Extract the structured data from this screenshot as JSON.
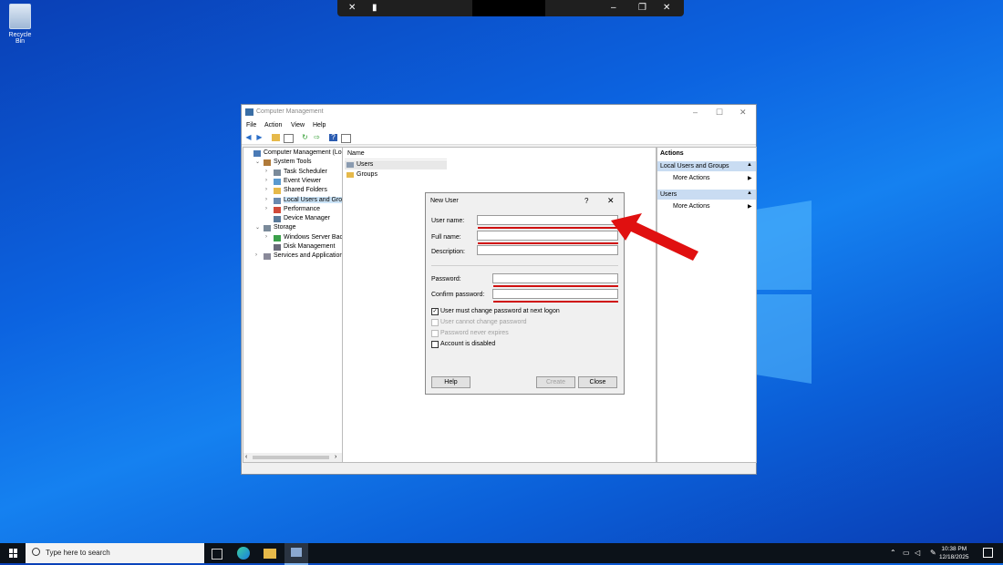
{
  "desktop": {
    "recycle_bin_label": "Recycle Bin"
  },
  "window": {
    "title": "Computer Management",
    "menu": [
      "File",
      "Action",
      "View",
      "Help"
    ],
    "tree": [
      {
        "label": "Computer Management (Local",
        "level": 0,
        "icon": "computer-icon",
        "expander": ""
      },
      {
        "label": "System Tools",
        "level": 1,
        "icon": "tools-icon",
        "expander": "v"
      },
      {
        "label": "Task Scheduler",
        "level": 2,
        "icon": "clock-icon",
        "expander": ">"
      },
      {
        "label": "Event Viewer",
        "level": 2,
        "icon": "event-viewer-icon",
        "expander": ">"
      },
      {
        "label": "Shared Folders",
        "level": 2,
        "icon": "folder-icon",
        "expander": ">"
      },
      {
        "label": "Local Users and Groups",
        "level": 2,
        "icon": "users-icon",
        "expander": ">",
        "selected": true
      },
      {
        "label": "Performance",
        "level": 2,
        "icon": "performance-icon",
        "expander": ">"
      },
      {
        "label": "Device Manager",
        "level": 2,
        "icon": "device-manager-icon",
        "expander": ""
      },
      {
        "label": "Storage",
        "level": 1,
        "icon": "storage-icon",
        "expander": "v"
      },
      {
        "label": "Windows Server Backup",
        "level": 2,
        "icon": "backup-icon",
        "expander": ">"
      },
      {
        "label": "Disk Management",
        "level": 2,
        "icon": "disk-icon",
        "expander": ""
      },
      {
        "label": "Services and Applications",
        "level": 1,
        "icon": "services-icon",
        "expander": ">"
      }
    ],
    "list_header": "Name",
    "list_items": [
      "Users",
      "Groups"
    ],
    "actions": {
      "title": "Actions",
      "sections": [
        {
          "header": "Local Users and Groups",
          "item": "More Actions"
        },
        {
          "header": "Users",
          "item": "More Actions"
        }
      ]
    }
  },
  "dialog": {
    "title": "New User",
    "help_glyph": "?",
    "close_glyph": "✕",
    "fields": {
      "user_name": {
        "label": "User name:",
        "value": ""
      },
      "full_name": {
        "label": "Full name:",
        "value": ""
      },
      "description": {
        "label": "Description:",
        "value": ""
      },
      "password": {
        "label": "Password:",
        "value": ""
      },
      "confirm_password": {
        "label": "Confirm password:",
        "value": ""
      }
    },
    "checkboxes": [
      {
        "label": "User must change password at next logon",
        "checked": true,
        "enabled": true
      },
      {
        "label": "User cannot change password",
        "checked": false,
        "enabled": false
      },
      {
        "label": "Password never expires",
        "checked": false,
        "enabled": false
      },
      {
        "label": "Account is disabled",
        "checked": false,
        "enabled": true
      }
    ],
    "buttons": {
      "help": "Help",
      "create": "Create",
      "close": "Close"
    }
  },
  "taskbar": {
    "search_placeholder": "Type here to search",
    "time": "10:38 PM",
    "date": "12/18/2025"
  },
  "colors": {
    "annotation_red": "#e01010",
    "selection": "#cce4f7",
    "actions_header": "#c9dcf2"
  }
}
